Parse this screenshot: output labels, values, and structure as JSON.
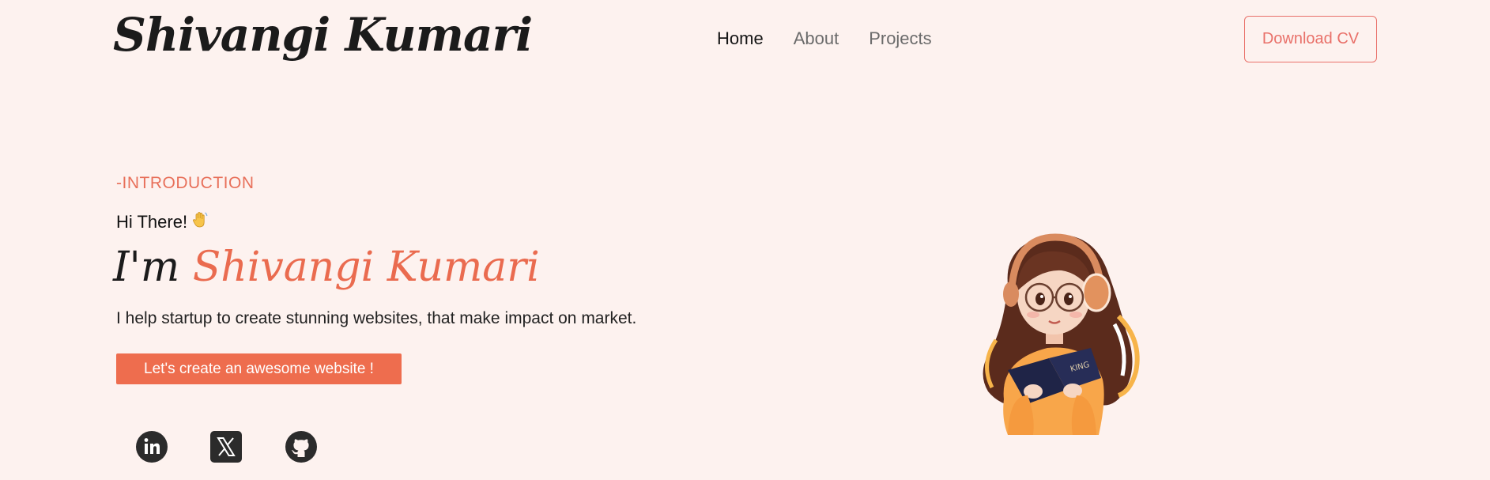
{
  "header": {
    "logo_text": "Shivangi Kumari",
    "nav": [
      {
        "label": "Home",
        "active": true
      },
      {
        "label": "About",
        "active": false
      },
      {
        "label": "Projects",
        "active": false
      }
    ],
    "download_cv_label": "Download CV"
  },
  "hero": {
    "section_label": "-INTRODUCTION",
    "greeting": "Hi There!",
    "greeting_emoji": "waving-hand-icon",
    "headline_prefix": "I'm",
    "headline_name": "Shivangi Kumari",
    "tagline": "I help startup to create stunning websites, that make impact on market.",
    "cta_label": "Let's create an awesome website !",
    "book_text": "KING"
  },
  "social": [
    {
      "name": "linkedin-icon"
    },
    {
      "name": "x-twitter-icon"
    },
    {
      "name": "github-icon"
    }
  ],
  "colors": {
    "background": "#fdf2ef",
    "accent": "#ee6d4e",
    "accent_text": "#e8705a",
    "outline": "#e9716a"
  }
}
